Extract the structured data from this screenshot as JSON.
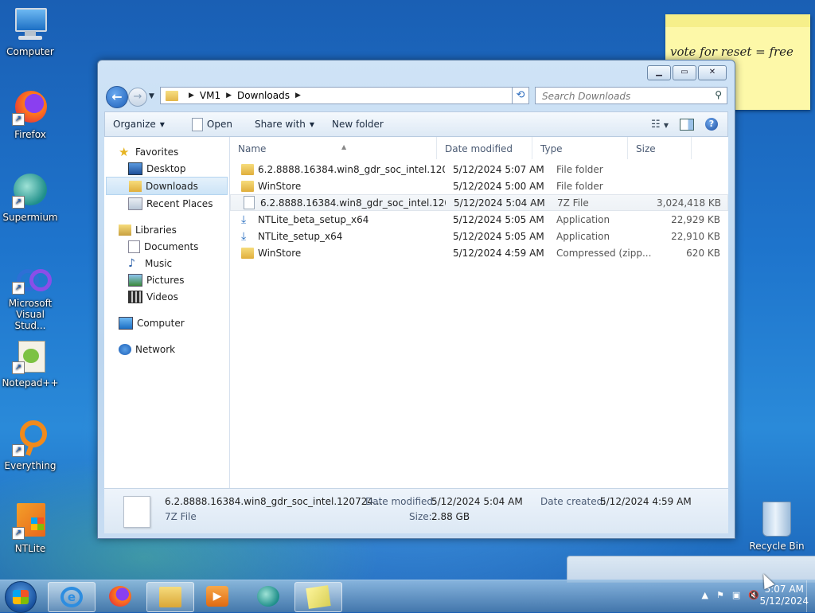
{
  "desktop": {
    "icons": [
      {
        "label": "Computer"
      },
      {
        "label": "Firefox"
      },
      {
        "label": "Supermium"
      },
      {
        "label": "Microsoft Visual Stud..."
      },
      {
        "label": "Notepad++"
      },
      {
        "label": "Everything"
      },
      {
        "label": "NTLite"
      }
    ],
    "recycle_bin": "Recycle Bin",
    "sticky_note": "vote for reset = free"
  },
  "window": {
    "address": {
      "segments": [
        "VM1",
        "Downloads"
      ]
    },
    "search_placeholder": "Search Downloads",
    "toolbar": {
      "organize": "Organize",
      "open": "Open",
      "share_with": "Share with",
      "new_folder": "New folder"
    },
    "nav": {
      "favorites": "Favorites",
      "desktop": "Desktop",
      "downloads": "Downloads",
      "recent_places": "Recent Places",
      "libraries": "Libraries",
      "documents": "Documents",
      "music": "Music",
      "pictures": "Pictures",
      "videos": "Videos",
      "computer": "Computer",
      "network": "Network"
    },
    "columns": {
      "name": "Name",
      "date_modified": "Date modified",
      "type": "Type",
      "size": "Size"
    },
    "files": [
      {
        "name": "6.2.8888.16384.win8_gdr_soc_intel.120724...",
        "date": "5/12/2024 5:07 AM",
        "type": "File folder",
        "size": ""
      },
      {
        "name": "WinStore",
        "date": "5/12/2024 5:00 AM",
        "type": "File folder",
        "size": ""
      },
      {
        "name": "6.2.8888.16384.win8_gdr_soc_intel.120724...",
        "date": "5/12/2024 5:04 AM",
        "type": "7Z File",
        "size": "3,024,418 KB"
      },
      {
        "name": "NTLite_beta_setup_x64",
        "date": "5/12/2024 5:05 AM",
        "type": "Application",
        "size": "22,929 KB"
      },
      {
        "name": "NTLite_setup_x64",
        "date": "5/12/2024 5:05 AM",
        "type": "Application",
        "size": "22,910 KB"
      },
      {
        "name": "WinStore",
        "date": "5/12/2024 4:59 AM",
        "type": "Compressed (zipp...",
        "size": "620 KB"
      }
    ],
    "details": {
      "filename": "6.2.8888.16384.win8_gdr_soc_intel.120724...",
      "filetype": "7Z File",
      "date_modified_label": "Date modified:",
      "date_modified": "5/12/2024 5:04 AM",
      "size_label": "Size:",
      "size": "2.88 GB",
      "date_created_label": "Date created:",
      "date_created": "5/12/2024 4:59 AM"
    }
  },
  "taskbar": {
    "time": "5:07 AM",
    "date": "5/12/2024"
  },
  "colors": {
    "selection": "#cce4f7",
    "accent": "#1c5fb8"
  }
}
